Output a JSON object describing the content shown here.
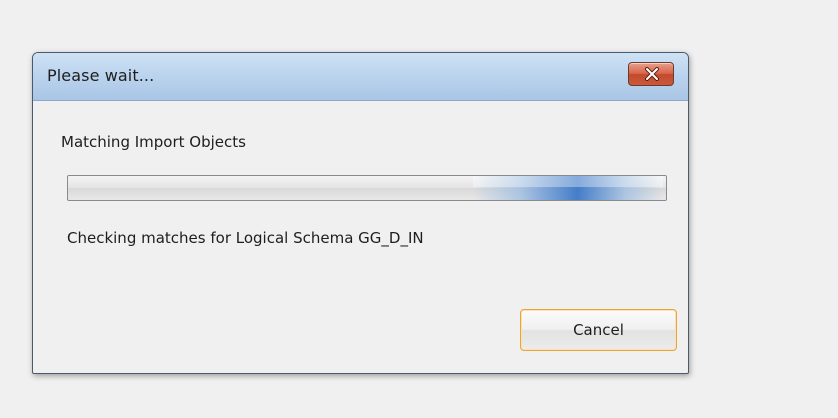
{
  "dialog": {
    "title": "Please wait...",
    "close_icon": "close-icon",
    "heading": "Matching Import Objects",
    "status": "Checking matches for Logical Schema GG_D_IN",
    "progress": {
      "mode": "indeterminate",
      "accent_color": "#3c78c8"
    },
    "cancel_label": "Cancel"
  },
  "colors": {
    "titlebar": "#bcd4ee",
    "close_button": "#d8644a",
    "background": "#f0f0f0",
    "focus_border": "#eaa43a"
  }
}
